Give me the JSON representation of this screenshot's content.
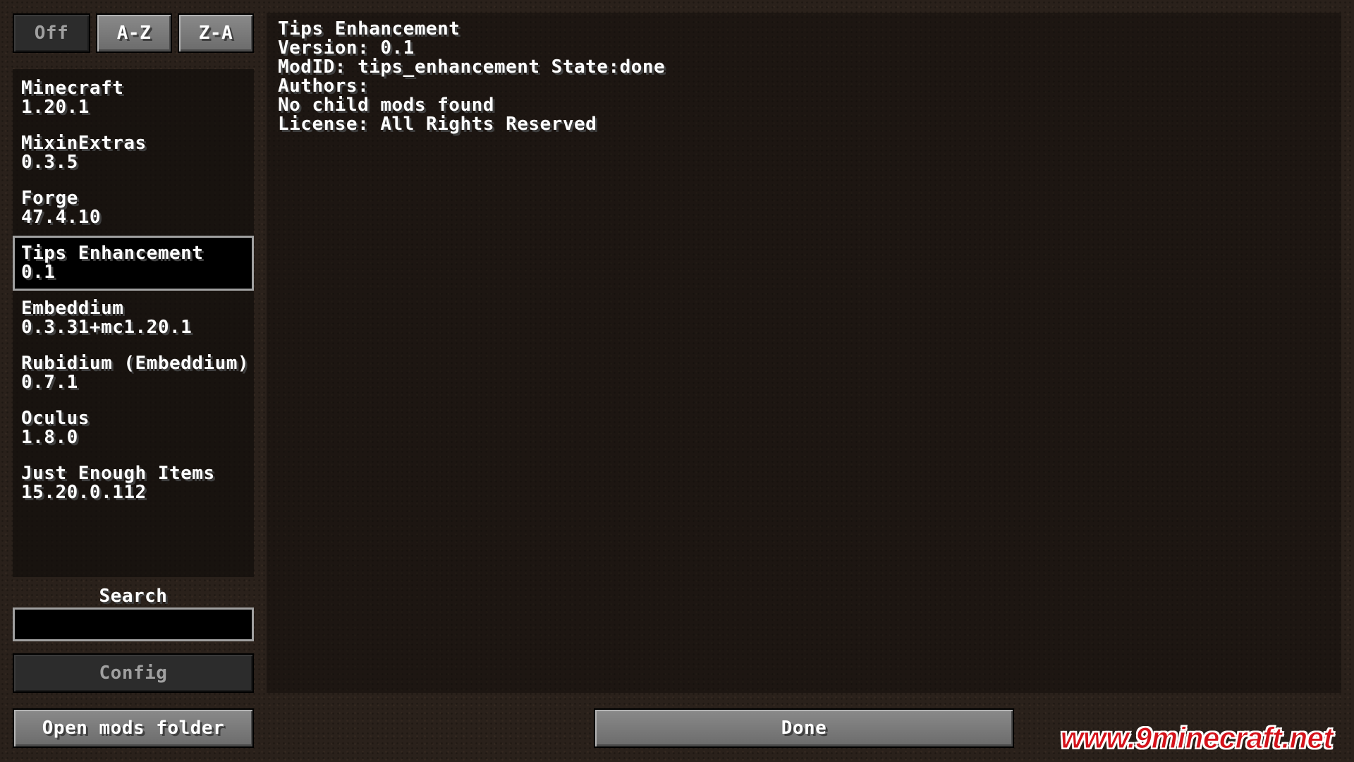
{
  "sort_buttons": {
    "off": "Off",
    "az": "A-Z",
    "za": "Z-A"
  },
  "mods": [
    {
      "name": "Minecraft",
      "version": "1.20.1"
    },
    {
      "name": "MixinExtras",
      "version": "0.3.5"
    },
    {
      "name": "Forge",
      "version": "47.4.10"
    },
    {
      "name": "Tips Enhancement",
      "version": "0.1"
    },
    {
      "name": "Embeddium",
      "version": "0.3.31+mc1.20.1"
    },
    {
      "name": "Rubidium (Embeddium)",
      "version": "0.7.1"
    },
    {
      "name": "Oculus",
      "version": "1.8.0"
    },
    {
      "name": "Just Enough Items",
      "version": "15.20.0.112"
    }
  ],
  "selected_mod_index": 3,
  "search": {
    "label": "Search",
    "value": ""
  },
  "buttons": {
    "config": "Config",
    "open_mods_folder": "Open mods folder",
    "done": "Done"
  },
  "info": {
    "title": "Tips Enhancement",
    "version_line": "Version: 0.1",
    "modid_line": "ModID: tips_enhancement State:done",
    "authors_line": "Authors:",
    "children_line": "No child mods found",
    "license_line": "License: All Rights Reserved"
  },
  "watermark": "www.9minecraft.net",
  "colors": {
    "background": "#2a211b",
    "button_enabled": "#7a7a7a",
    "button_disabled": "#2c2c2c",
    "selection_outline": "#a0a0a0",
    "watermark": "#d4121a"
  }
}
